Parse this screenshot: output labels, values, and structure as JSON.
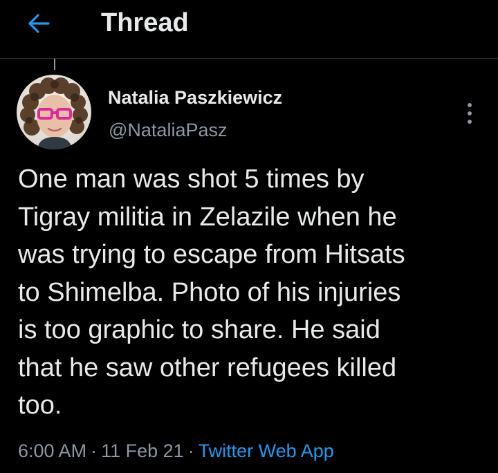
{
  "header": {
    "title": "Thread",
    "back_icon": "arrow-left-icon",
    "accent_color": "#1d9bf0"
  },
  "tweet": {
    "author_name": "Natalia Paszkiewicz",
    "author_handle": "@NataliaPasz",
    "avatar_icon": "user-avatar",
    "more_icon": "more-vertical-icon",
    "text_lines": [
      "One man was shot 5 times by",
      "Tigray militia in Zelazile when he",
      "was trying to escape from Hitsats",
      "to Shimelba. Photo of his injuries",
      "is too graphic to share. He said",
      "that he saw other refugees killed",
      "too."
    ],
    "time": "6:00 AM",
    "separator": "·",
    "date": "11 Feb 21",
    "source": "Twitter Web App"
  },
  "colors": {
    "background": "#000000",
    "text_primary": "#e7e9ea",
    "text_secondary": "#8b98a5",
    "link": "#1d9bf0",
    "divider": "#2f3336"
  }
}
